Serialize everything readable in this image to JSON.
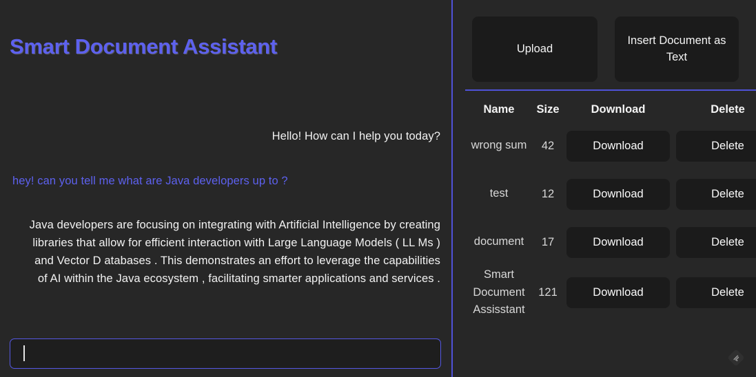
{
  "app": {
    "title": "Smart Document Assistant",
    "accent_color": "#5d61ef",
    "background_color": "#272727",
    "surface_color": "#1b1b1b"
  },
  "chat": {
    "messages": [
      {
        "role": "assistant",
        "text": "Hello! How can I help you today?"
      },
      {
        "role": "user",
        "text": "hey! can you tell me what are Java developers up to ?"
      },
      {
        "role": "assistant",
        "text": "Java developers are focusing on integrating with Artificial Intelligence by creating libraries that allow for efficient interaction with Large Language Models ( LL Ms ) and Vector D atabases . This demonstrates an effort to leverage the capabilities of AI within the Java ecosystem , facilitating smarter applications and services ."
      }
    ],
    "input": {
      "value": "",
      "placeholder": ""
    }
  },
  "documents_panel": {
    "actions": {
      "upload_label": "Upload",
      "insert_label": "Insert Document as Text"
    },
    "table": {
      "headers": [
        "Name",
        "Size",
        "Download",
        "Delete"
      ],
      "rows": [
        {
          "name": "wrong sum",
          "size": "42",
          "download_label": "Download",
          "delete_label": "Delete"
        },
        {
          "name": "test",
          "size": "12",
          "download_label": "Download",
          "delete_label": "Delete"
        },
        {
          "name": "document",
          "size": "17",
          "download_label": "Download",
          "delete_label": "Delete"
        },
        {
          "name": "Smart Document Assisstant",
          "size": "121",
          "download_label": "Download",
          "delete_label": "Delete"
        }
      ]
    }
  },
  "watermark": {
    "icon": "diamond-logo-icon"
  }
}
